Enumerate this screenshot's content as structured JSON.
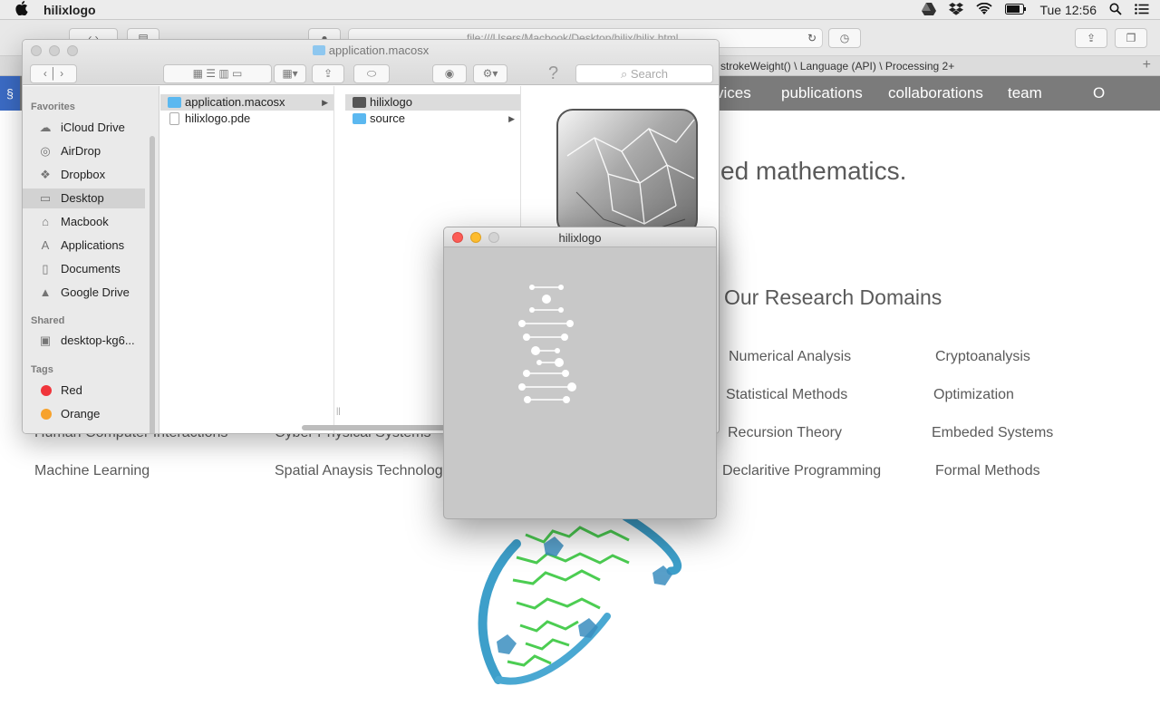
{
  "menubar": {
    "apple": "",
    "app_name": "hilixlogo",
    "clock": "Tue 12:56"
  },
  "browser": {
    "url": "file:///Users/Macbook/Desktop/hilix/hilix.html",
    "tab_title": "strokeWeight() \\ Language (API) \\ Processing 2+"
  },
  "site": {
    "nav": [
      "vices",
      "publications",
      "collaborations",
      "team",
      "O"
    ],
    "hero_text": "ed mathematics.",
    "domains_title": "Our Research Domains",
    "domains_right": [
      [
        "Numerical Analysis",
        "Cryptoanalysis"
      ],
      [
        "Statistical Methods",
        "Optimization"
      ],
      [
        "Recursion Theory",
        "Embeded Systems"
      ],
      [
        "Declaritive Programming",
        "Formal Methods"
      ]
    ],
    "domains_left_row3": [
      "Human Computer Interactions",
      "Cyber Physical Systems"
    ],
    "domains_left_row4": [
      "Machine Learning",
      "Spatial Anaysis Technologi"
    ]
  },
  "finder": {
    "title": "application.macosx",
    "search_placeholder": "Search",
    "sidebar": {
      "favorites_label": "Favorites",
      "favorites": [
        {
          "label": "iCloud Drive",
          "icon": "cloud-icon"
        },
        {
          "label": "AirDrop",
          "icon": "airdrop-icon"
        },
        {
          "label": "Dropbox",
          "icon": "dropbox-icon"
        },
        {
          "label": "Desktop",
          "icon": "desktop-icon"
        },
        {
          "label": "Macbook",
          "icon": "home-icon"
        },
        {
          "label": "Applications",
          "icon": "applications-icon"
        },
        {
          "label": "Documents",
          "icon": "documents-icon"
        },
        {
          "label": "Google Drive",
          "icon": "google-drive-icon"
        }
      ],
      "shared_label": "Shared",
      "shared": [
        {
          "label": "desktop-kg6...",
          "icon": "computer-icon"
        }
      ],
      "tags_label": "Tags",
      "tags": [
        {
          "label": "Red",
          "color": "#f0353b"
        },
        {
          "label": "Orange",
          "color": "#f7a22c"
        }
      ],
      "selected": "Desktop"
    },
    "column1": [
      {
        "label": "application.macosx",
        "type": "folder"
      },
      {
        "label": "hilixlogo.pde",
        "type": "file"
      }
    ],
    "column2": [
      {
        "label": "hilixlogo",
        "type": "app"
      },
      {
        "label": "source",
        "type": "folder"
      }
    ]
  },
  "sketch": {
    "title": "hilixlogo",
    "background": "#c8c8c8"
  }
}
